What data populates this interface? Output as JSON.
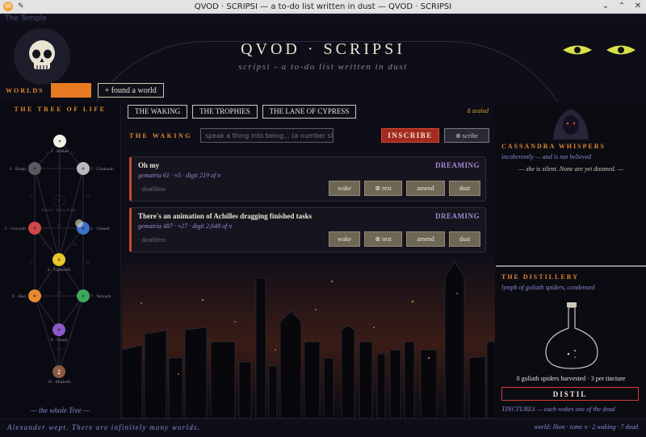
{
  "window": {
    "title": "QVOD · SCRIPSI — a to-do list written in dust — QVOD · SCRIPSI",
    "menu_hint": "The Temple",
    "app_icon": "W"
  },
  "header": {
    "title": "QVOD · SCRIPSI",
    "subtitle": "scripsi - a to-do list written in dust",
    "worlds_label": "WORLDS",
    "world_input_value": "",
    "found_world_label": "+ found a world"
  },
  "tree": {
    "title": "THE TREE OF LIFE",
    "hidden_label": "Daath - Knowledge",
    "hidden_number": "?",
    "footer": "— the whole Tree —",
    "sephirot": [
      {
        "label": "1 · Kether",
        "color": "#f2efe6"
      },
      {
        "label": "3 · Binah",
        "color": "#5a5a60"
      },
      {
        "label": "2 · Chokmah",
        "color": "#b9b9bd"
      },
      {
        "label": "5 · Gevurah",
        "color": "#d14646"
      },
      {
        "label": "4 · Chesed",
        "color": "#3f6fc8"
      },
      {
        "label": "6 · Tiphereth",
        "color": "#e8c82e"
      },
      {
        "label": "8 · Hod",
        "color": "#e88a2e"
      },
      {
        "label": "7 · Netzach",
        "color": "#3fa860"
      },
      {
        "label": "9 · Yesod",
        "color": "#8a5ac8"
      },
      {
        "label": "10 · Malkuth",
        "color": "#8a5a3e",
        "number": "2"
      }
    ],
    "path_numbers": [
      "11",
      "12",
      "13",
      "14",
      "15",
      "16",
      "17",
      "18",
      "19",
      "20",
      "21",
      "22"
    ]
  },
  "tabs": [
    "THE WAKING",
    "THE TROPHIES",
    "THE LANE OF CYPRESS"
  ],
  "sealed": "8 sealed",
  "waking": {
    "label": "THE WAKING",
    "input_placeholder": "speak a thing into being... (a number sle...",
    "inscribe_label": "INSCRIBE",
    "scribe_label": "⊕ scribe"
  },
  "tasks": [
    {
      "title": "Oh my",
      "status": "DREAMING",
      "meta": "gematria 61 · ≈5 · digit 219 of π",
      "tag": "· deathless",
      "actions": [
        "wake",
        "⊗ rest",
        "amend",
        "dust"
      ]
    },
    {
      "title": "There's an animation of Achilles dragging finished tasks",
      "status": "DREAMING",
      "meta": "gematria 487 · ≈27 · digit 2,648 of π",
      "tag": "· deathless",
      "actions": [
        "wake",
        "⊗ rest",
        "amend",
        "dust"
      ]
    }
  ],
  "cassandra": {
    "title": "CASSANDRA WHISPERS",
    "line1": "incoherently — and is not believed",
    "line2": "— she is silent. None are yet doomed. —"
  },
  "distillery": {
    "title": "THE DISTILLERY",
    "subtitle": "lymph of goliath spiders, condensed",
    "harvest": "0 goliath spiders harvested  ·  3 per tincture",
    "distil_label": "DISTIL",
    "tinctures": "TINCTURES — each wakes one of the dead"
  },
  "footer": {
    "left": "Alexander wept. There are infinitely many worlds.",
    "right": "world: Ilion · tome π · 2 waking · 7 dead"
  },
  "colors": {
    "accent": "#e08a2c",
    "violet": "#a58ad6",
    "link": "#8a8cd4",
    "danger": "#a42a20"
  }
}
